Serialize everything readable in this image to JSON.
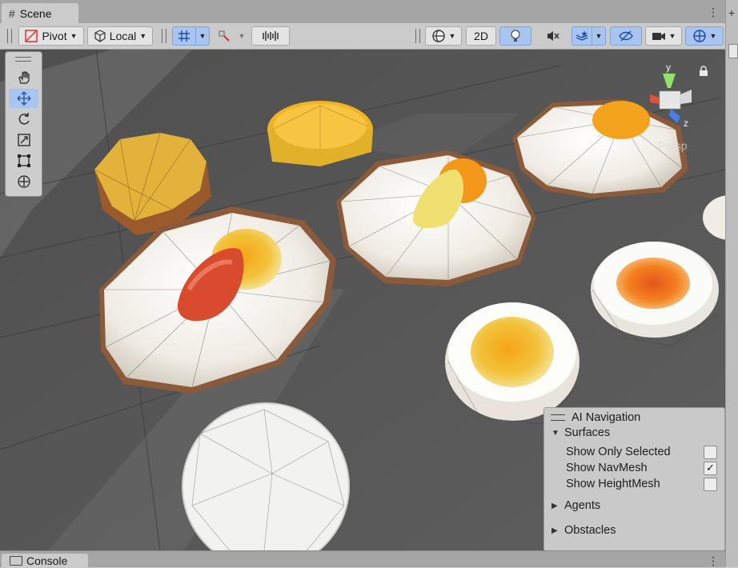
{
  "window": {
    "scene_tab": "Scene",
    "console_tab": "Console"
  },
  "toolbar": {
    "pivot_label": "Pivot",
    "local_label": "Local",
    "mode_2d_label": "2D"
  },
  "tools": [
    "hand-tool",
    "move-tool",
    "rotate-tool",
    "scale-tool",
    "rect-tool",
    "transform-tool"
  ],
  "active_tool": "move-tool",
  "gizmo": {
    "y_label": "y",
    "z_label": "z",
    "projection_label": "Persp"
  },
  "ai_navigation": {
    "title": "AI Navigation",
    "surfaces_label": "Surfaces",
    "options": [
      {
        "label": "Show Only Selected",
        "checked": false
      },
      {
        "label": "Show NavMesh",
        "checked": true
      },
      {
        "label": "Show HeightMesh",
        "checked": false
      }
    ],
    "agents_label": "Agents",
    "obstacles_label": "Obstacles"
  },
  "colors": {
    "toolbar_active": "#a9c5ef",
    "scene_background": "#5b5b5b",
    "gizmo_y": "#8fe36a",
    "gizmo_x": "#e0513b",
    "gizmo_z": "#4a7cf0"
  }
}
